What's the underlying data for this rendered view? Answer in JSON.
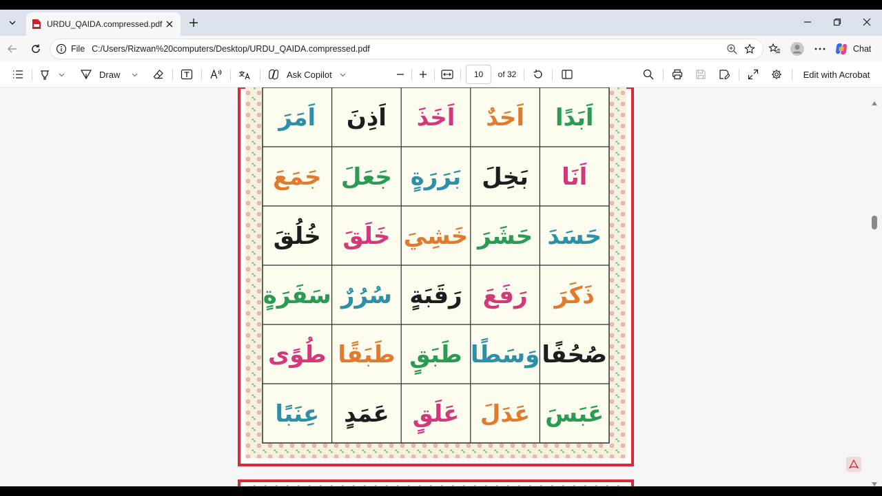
{
  "tab": {
    "title": "URDU_QAIDA.compressed.pdf",
    "favicon": "pdf-icon"
  },
  "address": {
    "scheme": "File",
    "url": "C:/Users/Rizwan%20computers/Desktop/URDU_QAIDA.compressed.pdf"
  },
  "chat": {
    "label": "Chat"
  },
  "toolbar": {
    "draw_label": "Draw",
    "copilot_label": "Ask Copilot",
    "page_current": "10",
    "page_total": "of 32",
    "acrobat_label": "Edit with Acrobat"
  },
  "qaida": {
    "rows": [
      [
        "اَبَدًا",
        "اَحَدٌ",
        "اَخَذَ",
        "اَذِنَ",
        "اَمَرَ"
      ],
      [
        "اَنَا",
        "بَخِلَ",
        "بَرَرَةٍ",
        "جَعَلَ",
        "جَمَعَ"
      ],
      [
        "حَسَدَ",
        "حَشَرَ",
        "خَشِيَ",
        "خَلَقَ",
        "خُلُقَ"
      ],
      [
        "ذَكَرَ",
        "رَفَعَ",
        "رَقَبَةٍ",
        "سُرُرٌ",
        "سَفَرَةٍ"
      ],
      [
        "صُحُفًا",
        "وَسَطًا",
        "طَبَقٍ",
        "طَبَقًا",
        "طُوًى"
      ],
      [
        "عَبَسَ",
        "عَدَلَ",
        "عَلَقٍ",
        "عَمَدٍ",
        "عِنَبًا"
      ]
    ],
    "colors": [
      "#2a9a55",
      "#e07a2e",
      "#d2387a",
      "#1d1d1d",
      "#2f8fa8"
    ]
  }
}
